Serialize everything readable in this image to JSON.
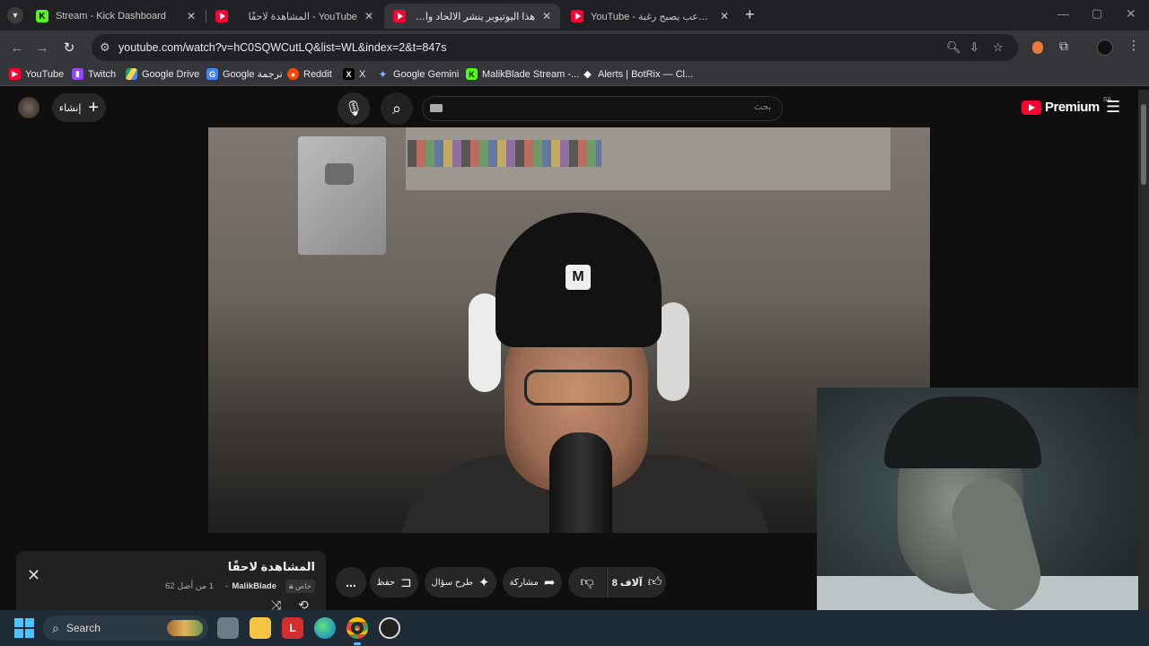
{
  "browser": {
    "tabs": [
      {
        "title": "Stream - Kick Dashboard",
        "icon": "kick-icon",
        "active": false
      },
      {
        "title": "YouTube - المشاهدة لاحقًا",
        "icon": "youtube-icon",
        "active": false
      },
      {
        "title": "هذا اليوتيوبر ينشر الالحاد والشذو...",
        "icon": "youtube-icon",
        "active": true
      },
      {
        "title": "YouTube - لما الرعب يصبح رغبة...",
        "icon": "youtube-icon",
        "active": false
      }
    ],
    "new_tab": "+",
    "url": "youtube.com/watch?v=hC0SQWCutLQ&list=WL&index=2&t=847s",
    "bookmarks": [
      {
        "label": "YouTube",
        "icon": "youtube-icon",
        "color": "#ff0033"
      },
      {
        "label": "Twitch",
        "icon": "twitch-icon",
        "color": "#9146ff"
      },
      {
        "label": "Google Drive",
        "icon": "drive-icon",
        "color": "#1fa463"
      },
      {
        "label": "Google ترجمة",
        "icon": "translate-icon",
        "color": "#4285f4"
      },
      {
        "label": "Reddit",
        "icon": "reddit-icon",
        "color": "#ff4500"
      },
      {
        "label": "X",
        "icon": "x-icon",
        "color": "#000000"
      },
      {
        "label": "Google Gemini",
        "icon": "gemini-icon",
        "color": "#8ab4f8"
      },
      {
        "label": "MalikBlade Stream -...",
        "icon": "kick-icon",
        "color": "#53fc18"
      },
      {
        "label": "Alerts | BotRix — Cl...",
        "icon": "botrix-icon",
        "color": "#ffffff"
      }
    ]
  },
  "youtube": {
    "create_label": "إنشاء",
    "search_placeholder": "بحث",
    "logo_text": "Premium",
    "logo_region": "SA",
    "playlist": {
      "title": "المشاهدة لاحقًا",
      "owner": "MalikBlade",
      "position": "1 من أصل 62",
      "privacy": "خاص"
    },
    "actions": {
      "likes": "8 آلاف",
      "share": "مشاركة",
      "ask": "طرح سؤال",
      "save": "حفظ",
      "more": "..."
    }
  },
  "taskbar": {
    "search_label": "Search"
  }
}
